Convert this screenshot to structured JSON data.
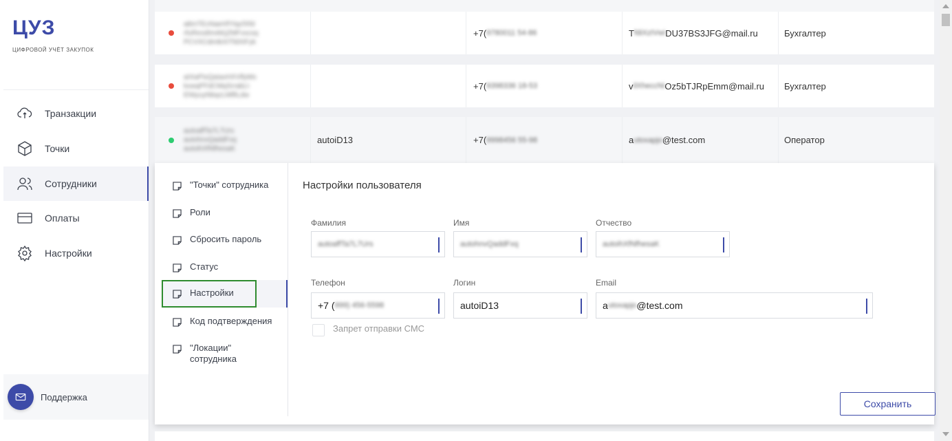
{
  "app": {
    "logo": "ЦУЗ",
    "logo_sub": "ЦИФРОВОЙ УЧЁТ ЗАКУПОК"
  },
  "sidebar": {
    "items": [
      {
        "label": "Транзакции",
        "icon": "cloud-sync-icon"
      },
      {
        "label": "Точки",
        "icon": "cube-icon"
      },
      {
        "label": "Сотрудники",
        "icon": "users-icon",
        "active": true
      },
      {
        "label": "Оплаты",
        "icon": "card-icon"
      },
      {
        "label": "Настройки",
        "icon": "gear-icon"
      }
    ],
    "support": "Поддержка"
  },
  "rows": [
    {
      "status_color": "#e84c3d",
      "name_lines": [
        "a8mTEcNaeHfYtqcfXfd",
        "rfuReodImAKjZMFvxcxq",
        "PCVXCdmIkXiTfdXIFyk"
      ],
      "login": "",
      "phone_prefix": "+7(",
      "phone_rest": "9780011 54-86",
      "email_prefix": "T",
      "email_blur": "fdiXzIVwi",
      "email_suffix": "DU37BS3JFG@mail.ru",
      "role": "Бухгалтер"
    },
    {
      "status_color": "#e84c3d",
      "name_lines": [
        "aIXaPIxQaIaxHXVlfyMs",
        "kxwqPFdCMqSrrabLt",
        "ENtyuyNbqcLMlfiLdw"
      ],
      "login": "",
      "phone_prefix": "+7(",
      "phone_rest": "9398336 18-53",
      "email_prefix": "v",
      "email_blur": "ilXheccNi",
      "email_suffix": "Oz5bTJRpEmm@mail.ru",
      "role": "Бухгалтер"
    },
    {
      "status_color": "#2ecc71",
      "name_lines": [
        "autoaffTa7L7Urs",
        "autohnvQaddFxq",
        "autoihXfNfhesaK"
      ],
      "login": "autoiD13",
      "phone_prefix": "+7(",
      "phone_rest": "9998456 55-98",
      "email_prefix": "a",
      "email_blur": "utoxapjo",
      "email_suffix": "@test.com",
      "role": "Оператор"
    }
  ],
  "panel": {
    "menu": [
      {
        "label": "\"Точки\" сотрудника"
      },
      {
        "label": "Роли"
      },
      {
        "label": "Сбросить пароль"
      },
      {
        "label": "Статус"
      },
      {
        "label": "Настройки",
        "active": true
      },
      {
        "label": "Код подтверждения"
      },
      {
        "label": "\"Локации\" сотрудника"
      }
    ],
    "title": "Настройки пользователя",
    "fields": {
      "surname": {
        "label": "Фамилия",
        "value": "autoaffTa7L7Urs"
      },
      "name": {
        "label": "Имя",
        "value": "autohnvQaddFxq"
      },
      "patronymic": {
        "label": "Отчество",
        "value": "autoihXfNfhesaK"
      },
      "phone": {
        "label": "Телефон",
        "prefix": "+7 (",
        "value": "999) 456-5598"
      },
      "login": {
        "label": "Логин",
        "value": "autoiD13"
      },
      "email": {
        "label": "Email",
        "prefix": "a",
        "blur": "utoxapjo",
        "suffix": "@test.com"
      }
    },
    "sms_checkbox_label": "Запрет отправки СМС",
    "save_label": "Сохранить"
  }
}
